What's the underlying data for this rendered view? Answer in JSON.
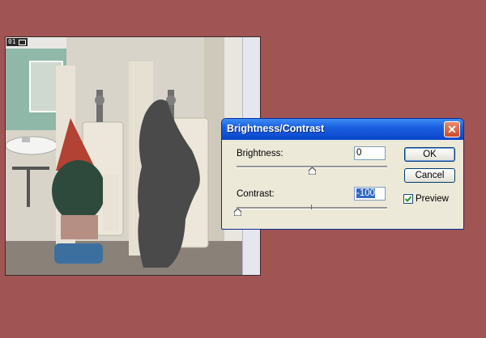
{
  "document": {
    "badge_number": "01",
    "badge_icon": "document-icon"
  },
  "dialog": {
    "title": "Brightness/Contrast",
    "brightness": {
      "label": "Brightness:",
      "value": "0",
      "slider_fraction": 0.5
    },
    "contrast": {
      "label": "Contrast:",
      "value": "-100",
      "slider_fraction": 0.0
    },
    "ok_label": "OK",
    "cancel_label": "Cancel",
    "preview_label": "Preview",
    "preview_checked": true
  },
  "colors": {
    "desktop_background": "#a05454",
    "titlebar": "#1a5fe0",
    "dialog_face": "#ece9d8"
  }
}
